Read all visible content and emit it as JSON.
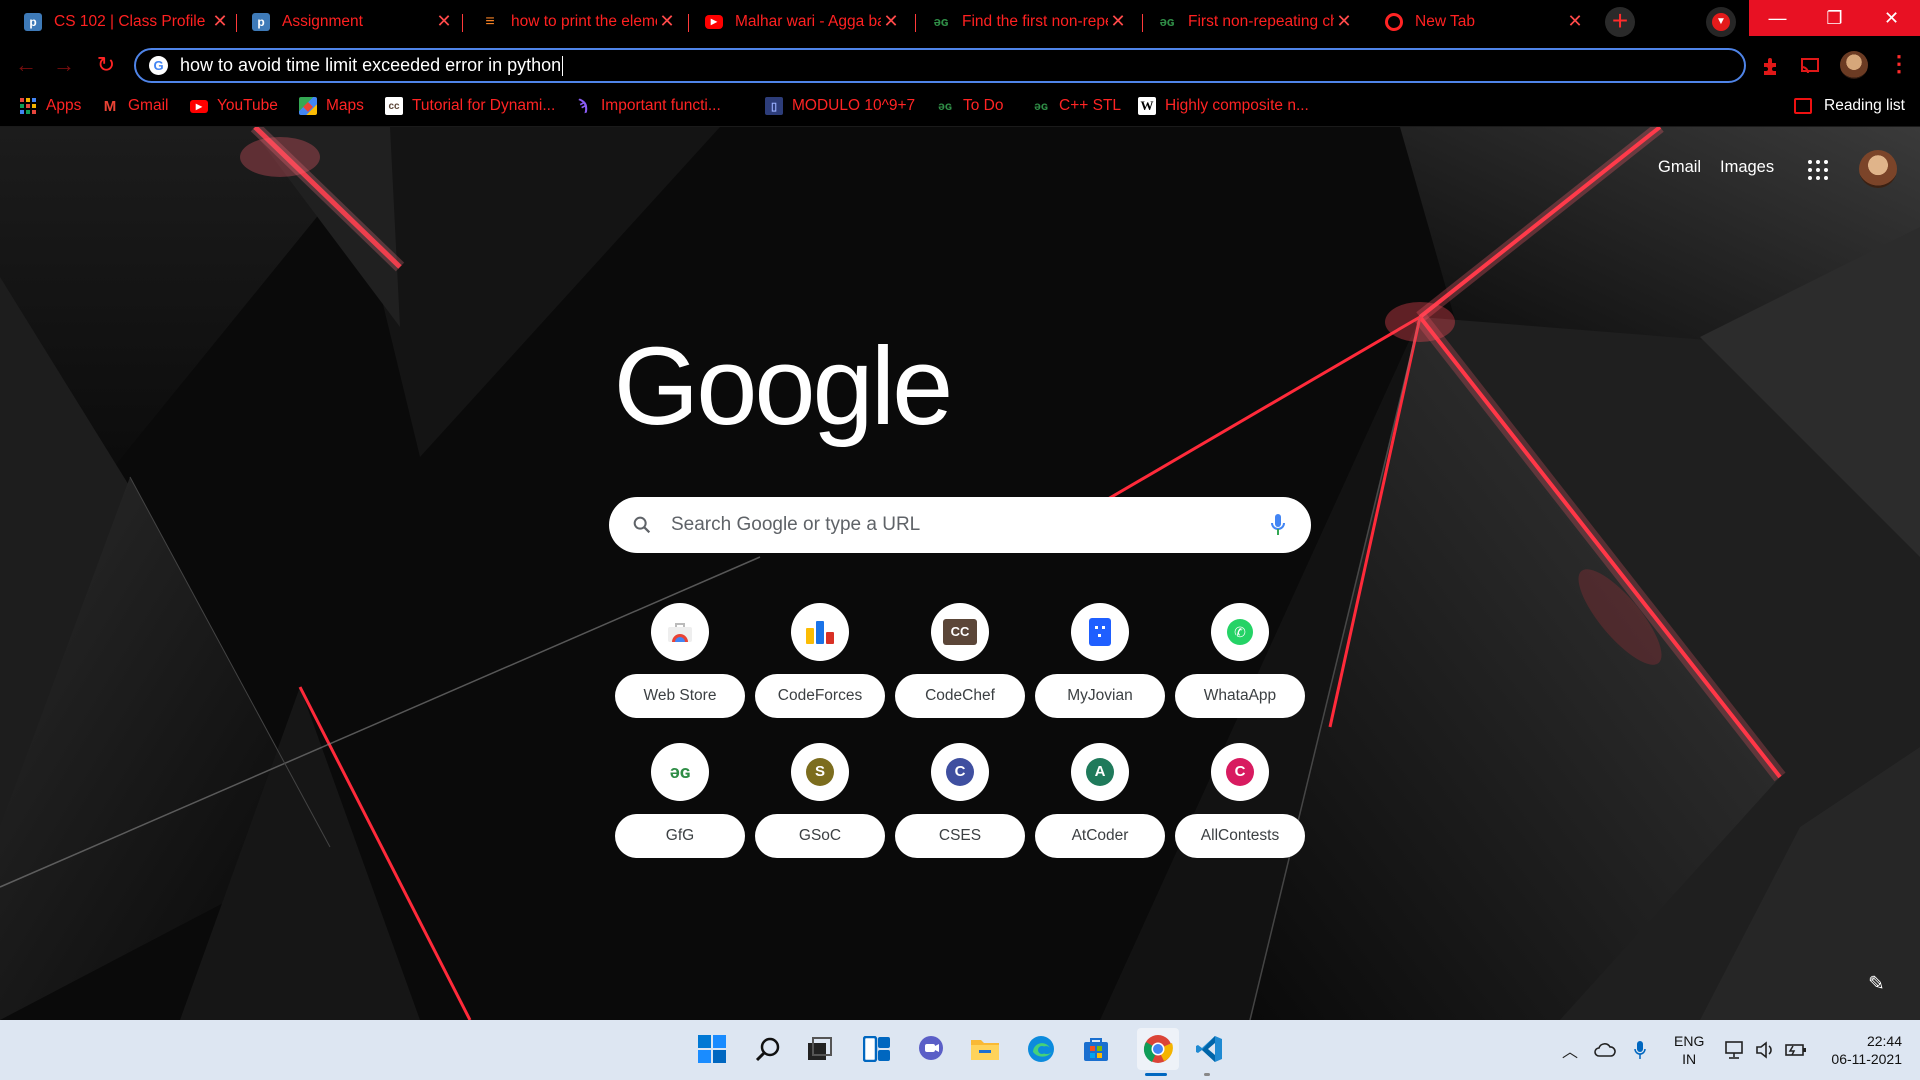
{
  "tabs": [
    {
      "title": "CS 102 | Class Profile | ...",
      "icon": "piazza-icon",
      "color": "#3e7ab8"
    },
    {
      "title": "Assignment",
      "icon": "piazza-icon",
      "color": "#3e7ab8"
    },
    {
      "title": "how to print the elements",
      "icon": "stackoverflow-icon",
      "color": "#f48024"
    },
    {
      "title": "Malhar wari - Agga bai",
      "icon": "youtube-icon",
      "color": "#ff0000"
    },
    {
      "title": "Find the first non-repeating",
      "icon": "gfg-icon",
      "color": "#2f8d46"
    },
    {
      "title": "First non-repeating character",
      "icon": "gfg-icon",
      "color": "#2f8d46"
    },
    {
      "title": "New Tab",
      "icon": "chrome-icon",
      "color": "#ff2424"
    }
  ],
  "omnibox": {
    "text": "how to avoid time limit exceeded error in python"
  },
  "bookmarks": [
    {
      "label": "Apps",
      "icon": "apps-grid-icon"
    },
    {
      "label": "Gmail",
      "icon": "gmail-icon"
    },
    {
      "label": "YouTube",
      "icon": "youtube-icon"
    },
    {
      "label": "Maps",
      "icon": "maps-icon"
    },
    {
      "label": "Tutorial for Dynami...",
      "icon": "codechef-icon"
    },
    {
      "label": "Important functi...",
      "icon": "feather-icon"
    },
    {
      "label": "MODULO 10^9+7",
      "icon": "document-icon"
    },
    {
      "label": "To Do",
      "icon": "gfg-icon"
    },
    {
      "label": "C++ STL",
      "icon": "gfg-icon"
    },
    {
      "label": "Highly composite n...",
      "icon": "wikipedia-icon"
    }
  ],
  "reading_list": "Reading list",
  "top_links": {
    "gmail": "Gmail",
    "images": "Images"
  },
  "logo": "Google",
  "search": {
    "placeholder": "Search Google or type a URL"
  },
  "shortcuts": [
    {
      "label": "Web Store",
      "icon": "web-store-icon"
    },
    {
      "label": "CodeForces",
      "icon": "codeforces-icon"
    },
    {
      "label": "CodeChef",
      "icon": "codechef-icon"
    },
    {
      "label": "MyJovian",
      "icon": "jovian-icon"
    },
    {
      "label": "WhataApp",
      "icon": "whatsapp-icon"
    },
    {
      "label": "GfG",
      "icon": "gfg-icon"
    },
    {
      "label": "GSoC",
      "letter": "S",
      "color": "#7c6d1e"
    },
    {
      "label": "CSES",
      "letter": "C",
      "color": "#3f4fa0"
    },
    {
      "label": "AtCoder",
      "letter": "A",
      "color": "#1f7a5b"
    },
    {
      "label": "AllContests",
      "letter": "C",
      "color": "#d81b60"
    }
  ],
  "taskbar": {
    "apps": [
      "windows-start-icon",
      "search-icon",
      "task-view-icon",
      "widgets-icon",
      "chat-icon",
      "file-explorer-icon",
      "edge-icon",
      "store-icon",
      "chrome-icon",
      "vscode-icon"
    ],
    "lang_line1": "ENG",
    "lang_line2": "IN",
    "time": "22:44",
    "date": "06-11-2021"
  }
}
